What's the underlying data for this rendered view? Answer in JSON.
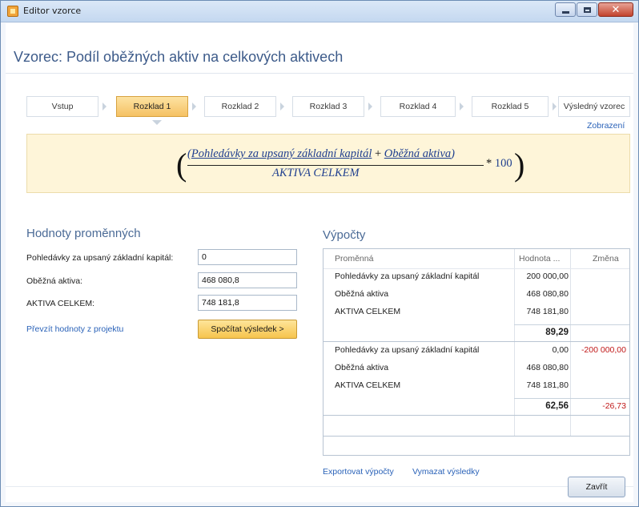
{
  "window": {
    "title": "Editor vzorce",
    "minimize_icon": "minimize-icon",
    "maximize_icon": "maximize-icon",
    "close_icon": "close-icon"
  },
  "heading": "Vzorec: Podíl oběžných aktiv na celkových aktivech",
  "steps": [
    {
      "label": "Vstup",
      "active": false
    },
    {
      "label": "Rozklad 1",
      "active": true
    },
    {
      "label": "Rozklad 2",
      "active": false
    },
    {
      "label": "Rozklad 3",
      "active": false
    },
    {
      "label": "Rozklad 4",
      "active": false
    },
    {
      "label": "Rozklad 5",
      "active": false
    },
    {
      "label": "Výsledný vzorec",
      "active": false
    }
  ],
  "view_link": "Zobrazení",
  "formula": {
    "numerator_a": "Pohledávky za upsaný základní kapitál",
    "plus": "+",
    "numerator_b": "Oběžná aktiva",
    "denominator": "AKTIVA CELKEM",
    "multiply": "*",
    "multiplier": "100",
    "open_paren": "(",
    "close_paren": ")"
  },
  "variables": {
    "title": "Hodnoty proměnných",
    "items": [
      {
        "label": "Pohledávky za upsaný základní kapitál:",
        "value": "0"
      },
      {
        "label": "Oběžná aktiva:",
        "value": "468 080,8"
      },
      {
        "label": "AKTIVA CELKEM:",
        "value": "748 181,8"
      }
    ],
    "import_link": "Převzít hodnoty z projektu",
    "calc_button": "Spočítat výsledek >"
  },
  "calculations": {
    "title": "Výpočty",
    "columns": [
      "Proměnná",
      "Hodnota ...",
      "Změna"
    ],
    "groups": [
      {
        "rows": [
          {
            "name": "Pohledávky za upsaný základní kapitál",
            "value": "200 000,00",
            "change": ""
          },
          {
            "name": "Oběžná aktiva",
            "value": "468 080,80",
            "change": ""
          },
          {
            "name": "AKTIVA CELKEM",
            "value": "748 181,80",
            "change": ""
          }
        ],
        "result": "89,29",
        "result_change": ""
      },
      {
        "rows": [
          {
            "name": "Pohledávky za upsaný základní kapitál",
            "value": "0,00",
            "change": "-200 000,00"
          },
          {
            "name": "Oběžná aktiva",
            "value": "468 080,80",
            "change": ""
          },
          {
            "name": "AKTIVA CELKEM",
            "value": "748 181,80",
            "change": ""
          }
        ],
        "result": "62,56",
        "result_change": "-26,73"
      }
    ],
    "export_link": "Exportovat výpočty",
    "clear_link": "Vymazat výsledky"
  },
  "close_button": "Zavřít",
  "colors": {
    "accent": "#3d5b8a",
    "link": "#2a62b8",
    "negative": "#c01818",
    "formula_bg": "#fef5d9",
    "active_step": "#f5c163"
  }
}
